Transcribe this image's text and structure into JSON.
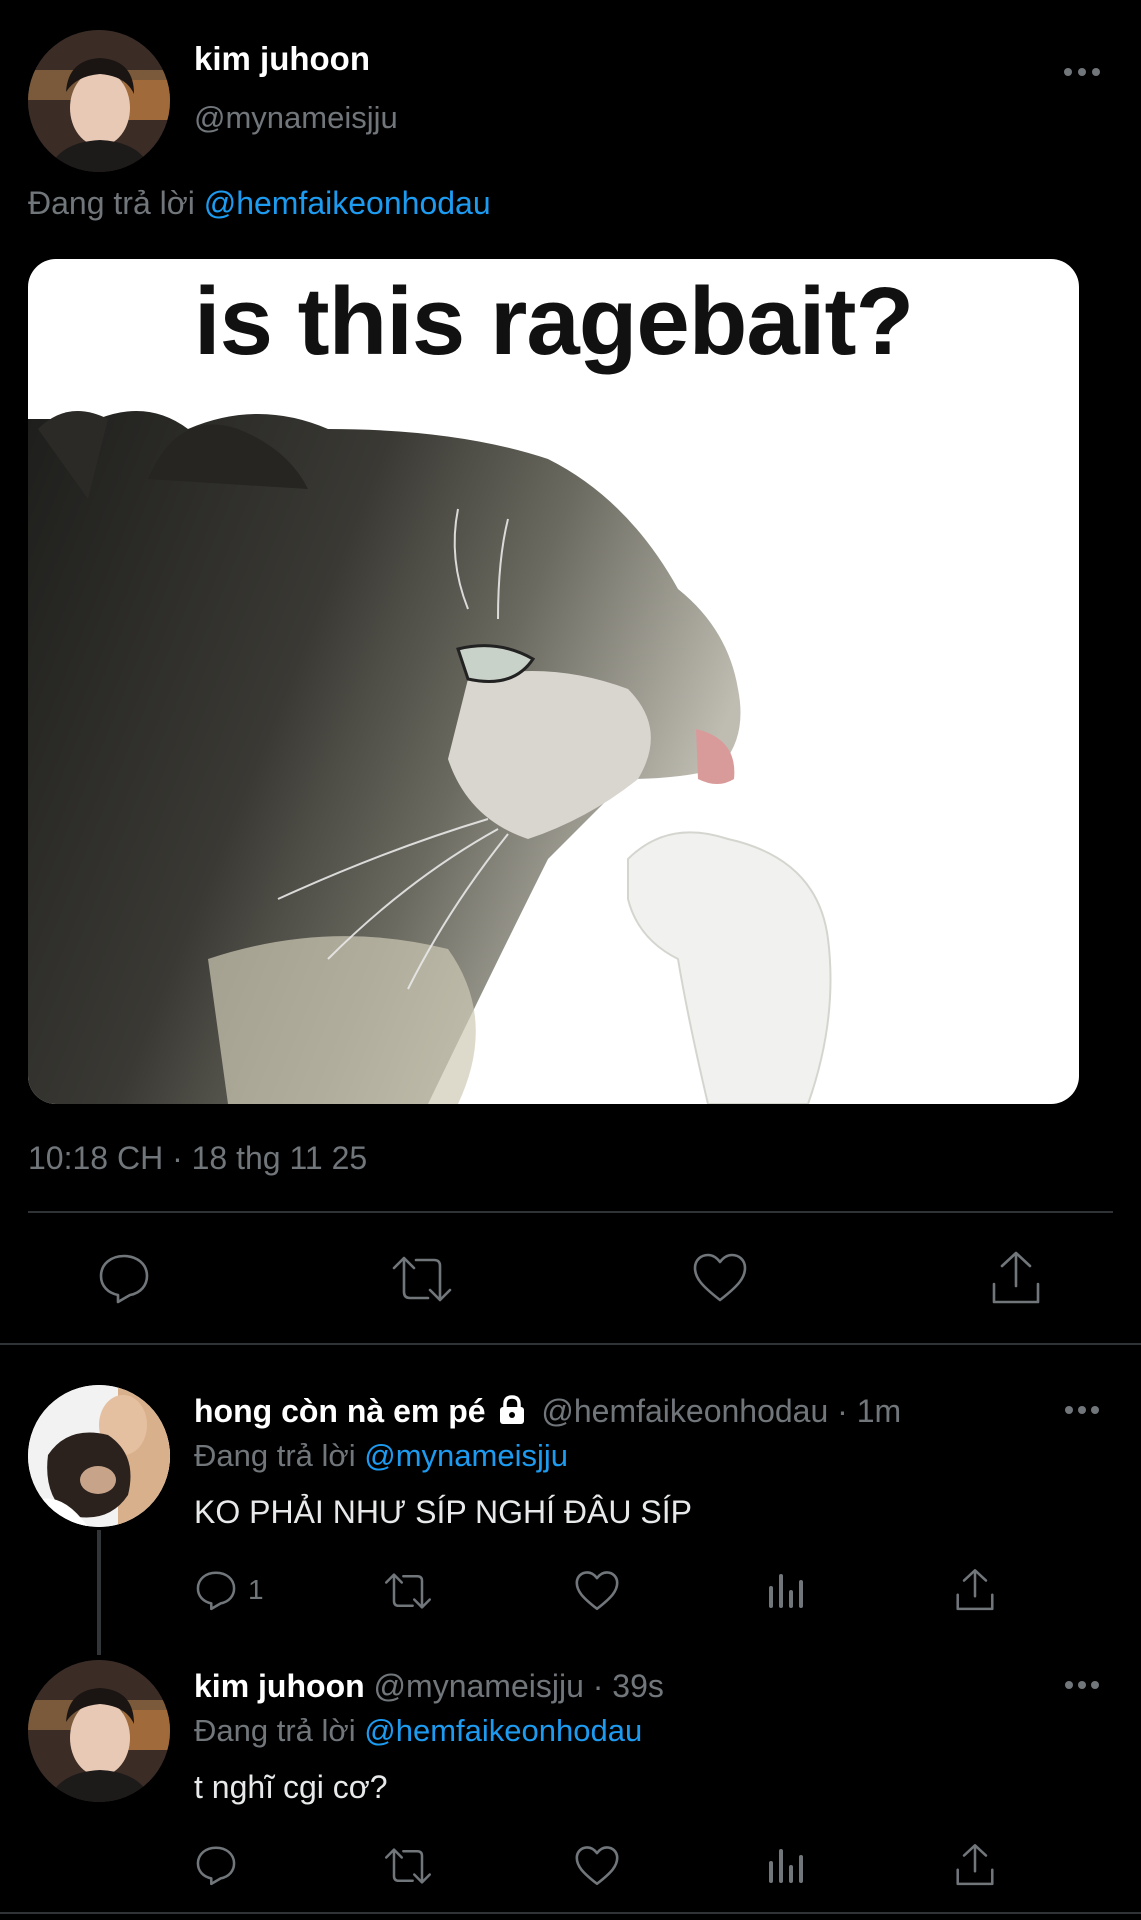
{
  "main_tweet": {
    "display_name": "kim juhoon",
    "handle": "@mynameisjju",
    "replying_label": "Đang trả lời",
    "replying_to": "@hemfaikeonhodau",
    "media_caption": "is this ragebait?",
    "timestamp": "10:18 CH · 18 thg 11 25"
  },
  "replies": [
    {
      "display_name": "hong còn nà em pé",
      "handle": "@hemfaikeonhodau",
      "time": "· 1m",
      "replying_label": "Đang trả lời",
      "replying_to": "@mynameisjju",
      "text": "KO PHẢI NHƯ SÍP NGHÍ ĐÂU SÍP",
      "reply_count": "1"
    },
    {
      "display_name": "kim juhoon",
      "handle": "@mynameisjju",
      "time": "· 39s",
      "replying_label": "Đang trả lời",
      "replying_to": "@hemfaikeonhodau",
      "text": "t nghĩ cgi cơ?",
      "reply_count": ""
    }
  ],
  "colors": {
    "background": "#000000",
    "link": "#1d9bf0",
    "muted": "#71767b",
    "divider": "#2f3336"
  },
  "icons": [
    "more-icon",
    "reply-icon",
    "retweet-icon",
    "like-icon",
    "share-icon",
    "views-icon",
    "lock-icon"
  ]
}
